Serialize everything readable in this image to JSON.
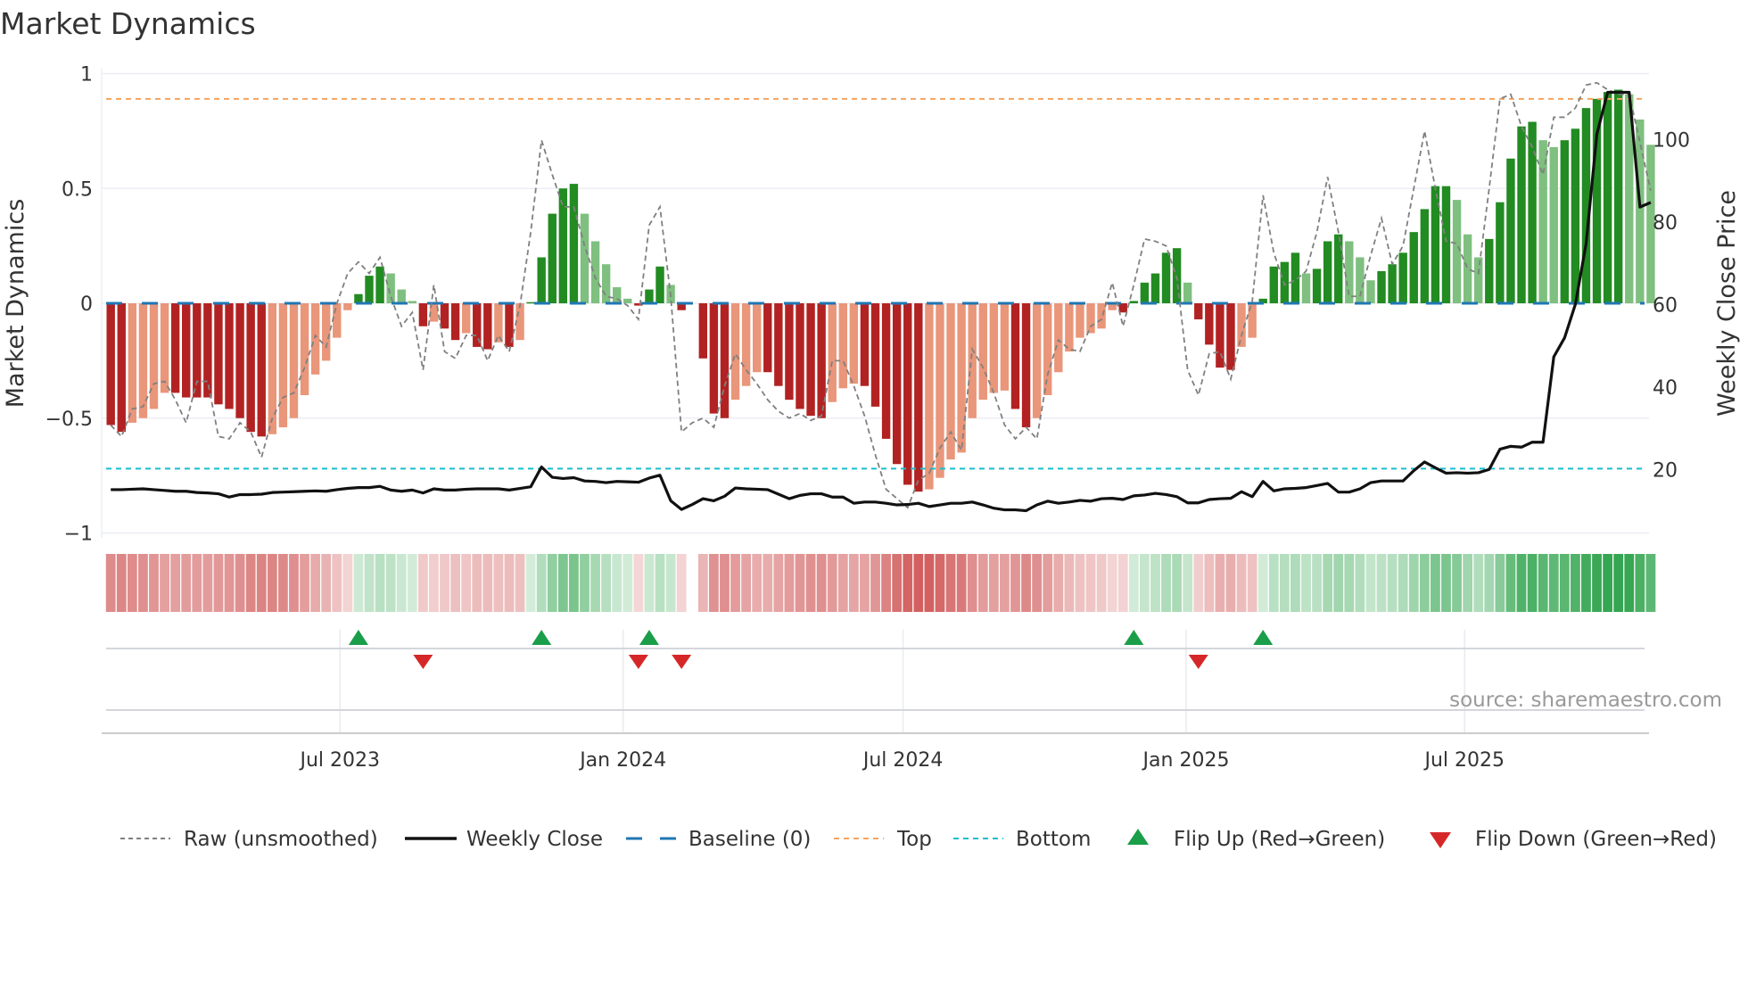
{
  "title": "Market Dynamics",
  "source": "source: sharemaestro.com",
  "colors": {
    "dark_red": "#b22222",
    "light_red": "#e9967a",
    "dark_green": "#228b22",
    "light_green": "#7fbf7f",
    "baseline": "#1f77b4",
    "top": "#f4a460",
    "bottom": "#17becf",
    "raw": "#808080",
    "close": "#111111",
    "flip_up": "#1a9e4a",
    "flip_down": "#d62728"
  },
  "legend": [
    {
      "key": "raw",
      "label": "Raw (unsmoothed)"
    },
    {
      "key": "close",
      "label": "Weekly Close"
    },
    {
      "key": "baseline",
      "label": "Baseline (0)"
    },
    {
      "key": "top",
      "label": "Top"
    },
    {
      "key": "bottom",
      "label": "Bottom"
    },
    {
      "key": "flip_up",
      "label": "Flip Up (Red→Green)"
    },
    {
      "key": "flip_down",
      "label": "Flip Down (Green→Red)"
    }
  ],
  "chart_data": {
    "type": "bar",
    "title": "Market Dynamics",
    "ylabel": "Market Dynamics",
    "y2label": "Weekly Close Price",
    "ylim": [
      -1,
      1
    ],
    "y2lim": [
      3.4,
      117
    ],
    "yticks": [
      {
        "v": 1,
        "label": "1"
      },
      {
        "v": 0.5,
        "label": "0.5"
      },
      {
        "v": 0,
        "label": "0"
      },
      {
        "v": -0.5,
        "label": "−0.5"
      },
      {
        "v": -1,
        "label": "−1"
      }
    ],
    "y2ticks": [
      {
        "v": 100,
        "label": "100"
      },
      {
        "v": 80,
        "label": "80"
      },
      {
        "v": 60,
        "label": "60"
      },
      {
        "v": 40,
        "label": "40"
      },
      {
        "v": 20,
        "label": "20"
      }
    ],
    "xticks": [
      {
        "date": "2023-07-01",
        "label": "Jul 2023"
      },
      {
        "date": "2024-01-01",
        "label": "Jan 2024"
      },
      {
        "date": "2024-07-01",
        "label": "Jul 2024"
      },
      {
        "date": "2025-01-01",
        "label": "Jan 2025"
      },
      {
        "date": "2025-07-01",
        "label": "Jul 2025"
      }
    ],
    "grid": true,
    "legend_position": "bottom",
    "start_date": "2023-02-01",
    "frequency": "weekly",
    "top_level": 0.89,
    "bottom_level": -0.72,
    "baseline": 0,
    "smoothed": [
      -0.53,
      -0.56,
      -0.52,
      -0.5,
      -0.46,
      -0.39,
      -0.39,
      -0.41,
      -0.41,
      -0.41,
      -0.44,
      -0.46,
      -0.5,
      -0.56,
      -0.58,
      -0.57,
      -0.54,
      -0.5,
      -0.4,
      -0.31,
      -0.25,
      -0.15,
      -0.03,
      0.04,
      0.12,
      0.16,
      0.13,
      0.06,
      0.01,
      -0.1,
      -0.08,
      -0.11,
      -0.16,
      -0.13,
      -0.19,
      -0.2,
      -0.17,
      -0.19,
      -0.16,
      0.005,
      0.2,
      0.39,
      0.5,
      0.52,
      0.39,
      0.27,
      0.17,
      0.07,
      0.02,
      -0.01,
      0.06,
      0.16,
      0.08,
      -0.03,
      null,
      -0.24,
      -0.48,
      -0.5,
      -0.42,
      -0.36,
      -0.3,
      -0.3,
      -0.36,
      -0.42,
      -0.46,
      -0.49,
      -0.5,
      -0.43,
      -0.37,
      -0.35,
      -0.36,
      -0.45,
      -0.59,
      -0.7,
      -0.79,
      -0.82,
      -0.81,
      -0.76,
      -0.68,
      -0.65,
      -0.5,
      -0.42,
      -0.39,
      -0.38,
      -0.46,
      -0.54,
      -0.5,
      -0.4,
      -0.3,
      -0.21,
      -0.15,
      -0.13,
      -0.11,
      -0.03,
      -0.04,
      0.01,
      0.09,
      0.13,
      0.22,
      0.24,
      0.09,
      -0.07,
      -0.18,
      -0.28,
      -0.29,
      -0.19,
      -0.15,
      0.02,
      0.16,
      0.18,
      0.22,
      0.13,
      0.15,
      0.27,
      0.3,
      0.27,
      0.2,
      0.1,
      0.14,
      0.17,
      0.22,
      0.31,
      0.41,
      0.51,
      0.51,
      0.45,
      0.3,
      0.2,
      0.28,
      0.44,
      0.63,
      0.77,
      0.79,
      0.71,
      0.68,
      0.71,
      0.76,
      0.85,
      0.89,
      0.92,
      0.93,
      0.91,
      0.8,
      0.69
    ],
    "raw": [
      -0.53,
      -0.58,
      -0.46,
      -0.45,
      -0.35,
      -0.34,
      -0.42,
      -0.52,
      -0.34,
      -0.34,
      -0.58,
      -0.59,
      -0.52,
      -0.56,
      -0.67,
      -0.5,
      -0.41,
      -0.39,
      -0.28,
      -0.14,
      -0.19,
      0.0,
      0.13,
      0.18,
      0.13,
      0.2,
      0.03,
      -0.1,
      -0.04,
      -0.29,
      0.08,
      -0.21,
      -0.24,
      -0.14,
      -0.14,
      -0.25,
      -0.14,
      -0.21,
      -0.01,
      0.31,
      0.71,
      0.56,
      0.42,
      0.42,
      0.25,
      0.11,
      0.03,
      0.02,
      -0.01,
      -0.07,
      0.34,
      0.42,
      0.03,
      -0.56,
      -0.52,
      -0.5,
      -0.54,
      -0.36,
      -0.22,
      -0.29,
      -0.35,
      -0.42,
      -0.47,
      -0.5,
      -0.48,
      -0.51,
      -0.49,
      -0.25,
      -0.25,
      -0.36,
      -0.49,
      -0.66,
      -0.81,
      -0.85,
      -0.89,
      -0.77,
      -0.74,
      -0.63,
      -0.56,
      -0.64,
      -0.2,
      -0.28,
      -0.39,
      -0.53,
      -0.59,
      -0.54,
      -0.59,
      -0.31,
      -0.16,
      -0.2,
      -0.21,
      -0.1,
      -0.07,
      0.09,
      -0.1,
      0.08,
      0.28,
      0.27,
      0.25,
      0.11,
      -0.29,
      -0.4,
      -0.22,
      -0.21,
      -0.33,
      -0.14,
      0.01,
      0.47,
      0.22,
      0.08,
      0.1,
      0.14,
      0.31,
      0.55,
      0.31,
      0.03,
      0.03,
      0.21,
      0.37,
      0.17,
      0.25,
      0.5,
      0.75,
      0.5,
      0.27,
      0.26,
      0.15,
      0.13,
      0.5,
      0.89,
      0.91,
      0.77,
      0.68,
      0.56,
      0.81,
      0.81,
      0.85,
      0.95,
      0.96,
      0.93,
      0.91,
      0.91,
      0.7,
      0.49
    ],
    "close": [
      15.1,
      15.1,
      15.2,
      15.3,
      15.1,
      14.9,
      14.7,
      14.7,
      14.4,
      14.3,
      14.1,
      13.3,
      13.9,
      13.9,
      14.0,
      14.4,
      14.5,
      14.6,
      14.7,
      14.8,
      14.7,
      15.1,
      15.4,
      15.6,
      15.6,
      15.9,
      15.0,
      14.7,
      15.0,
      14.3,
      15.3,
      15.0,
      15.0,
      15.2,
      15.3,
      15.3,
      15.3,
      15.0,
      15.4,
      15.8,
      20.6,
      18.1,
      17.8,
      18.0,
      17.2,
      17.1,
      16.8,
      17.1,
      17.0,
      16.9,
      17.9,
      18.6,
      12.4,
      10.3,
      11.5,
      12.9,
      12.4,
      13.5,
      15.5,
      15.3,
      15.2,
      15.1,
      14.0,
      12.9,
      13.7,
      14.1,
      14.1,
      13.3,
      13.3,
      11.8,
      12.1,
      12.1,
      11.8,
      11.4,
      11.5,
      11.8,
      11.0,
      11.4,
      11.8,
      11.8,
      12.1,
      11.4,
      10.6,
      10.2,
      10.2,
      10.0,
      11.4,
      12.3,
      11.8,
      12.1,
      12.5,
      12.3,
      12.9,
      13.0,
      12.7,
      13.6,
      13.8,
      14.2,
      13.9,
      13.4,
      11.9,
      11.9,
      12.7,
      12.9,
      13.0,
      14.6,
      13.4,
      17.1,
      14.8,
      15.3,
      15.4,
      15.6,
      16.1,
      16.6,
      14.5,
      14.5,
      15.3,
      16.8,
      17.2,
      17.2,
      17.2,
      19.7,
      21.8,
      20.4,
      19.1,
      19.2,
      19.1,
      19.2,
      20.0,
      24.9,
      25.6,
      25.4,
      26.6,
      26.6,
      47.3,
      51.9,
      60.0,
      74.7,
      101.3,
      111.4,
      111.4,
      111.4,
      83.6,
      84.7
    ],
    "flip_up_weeks": [
      24,
      41,
      51,
      96,
      108
    ],
    "flip_down_weeks": [
      30,
      50,
      54,
      102
    ]
  }
}
